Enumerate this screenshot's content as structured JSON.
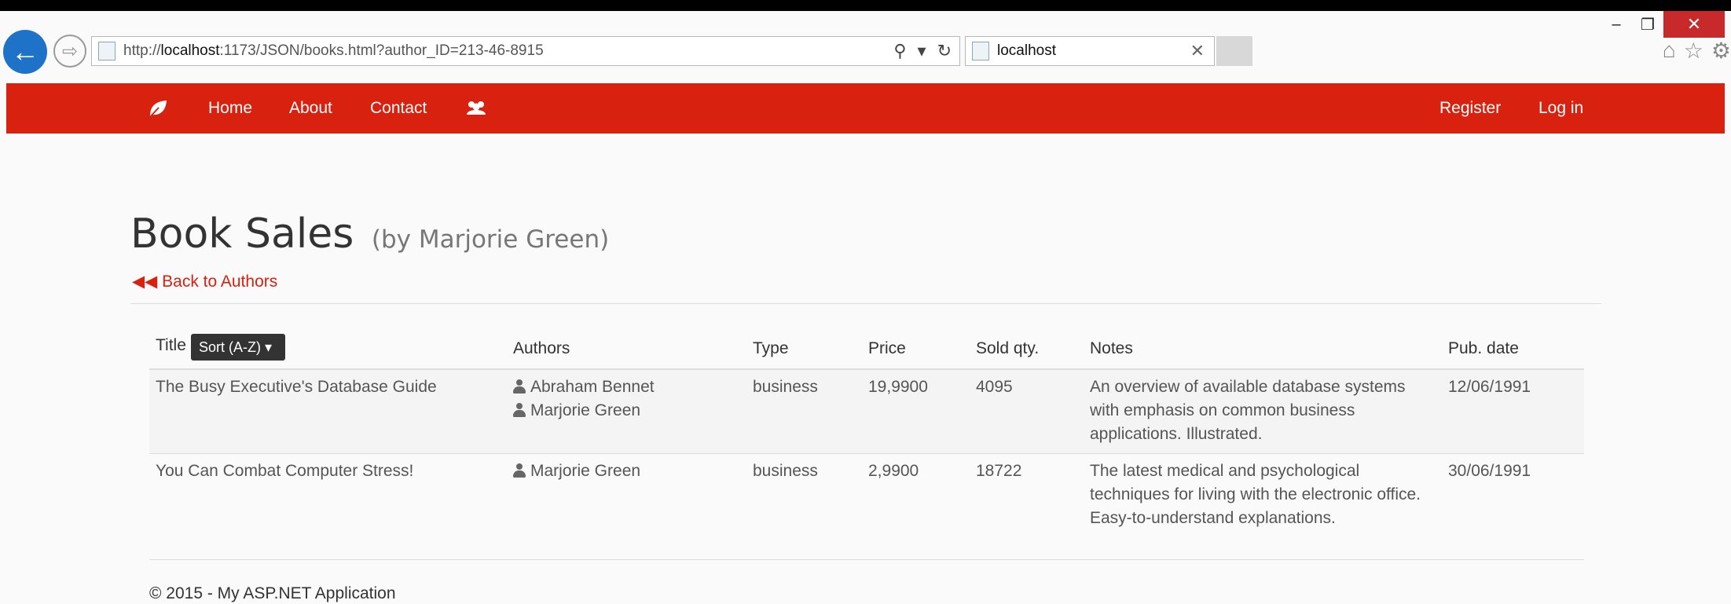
{
  "browser": {
    "url_prefix": "http://",
    "url_host": "localhost",
    "url_rest": ":1173/JSON/books.html?author_ID=213-46-8915",
    "tab_title": "localhost",
    "minimize": "–",
    "restore": "❐",
    "close": "✕",
    "tab_close": "✕"
  },
  "nav": {
    "brand_icon": "leaf-icon",
    "items": [
      "Home",
      "About",
      "Contact"
    ],
    "group_icon": "users-icon",
    "right": [
      "Register",
      "Log in"
    ]
  },
  "page": {
    "title": "Book Sales",
    "subtitle": "(by Marjorie Green)",
    "back_link": "Back to Authors",
    "sort_label": "Sort (A-Z)"
  },
  "table": {
    "headers": [
      "Title",
      "Authors",
      "Type",
      "Price",
      "Sold qty.",
      "Notes",
      "Pub. date"
    ],
    "rows": [
      {
        "title": "The Busy Executive's Database Guide",
        "authors": [
          "Abraham Bennet",
          "Marjorie Green"
        ],
        "type": "business",
        "price": "19,9900",
        "sold": "4095",
        "notes": "An overview of available database systems with emphasis on common business applications. Illustrated.",
        "pub_date": "12/06/1991"
      },
      {
        "title": "You Can Combat Computer Stress!",
        "authors": [
          "Marjorie Green"
        ],
        "type": "business",
        "price": "2,9900",
        "sold": "18722",
        "notes": "The latest medical and psychological techniques for living with the electronic office. Easy-to-understand explanations.",
        "pub_date": "30/06/1991"
      }
    ]
  },
  "footer": "© 2015 - My ASP.NET Application",
  "colors": {
    "brand": "#d8220f",
    "ie_blue": "#1e73c8"
  }
}
